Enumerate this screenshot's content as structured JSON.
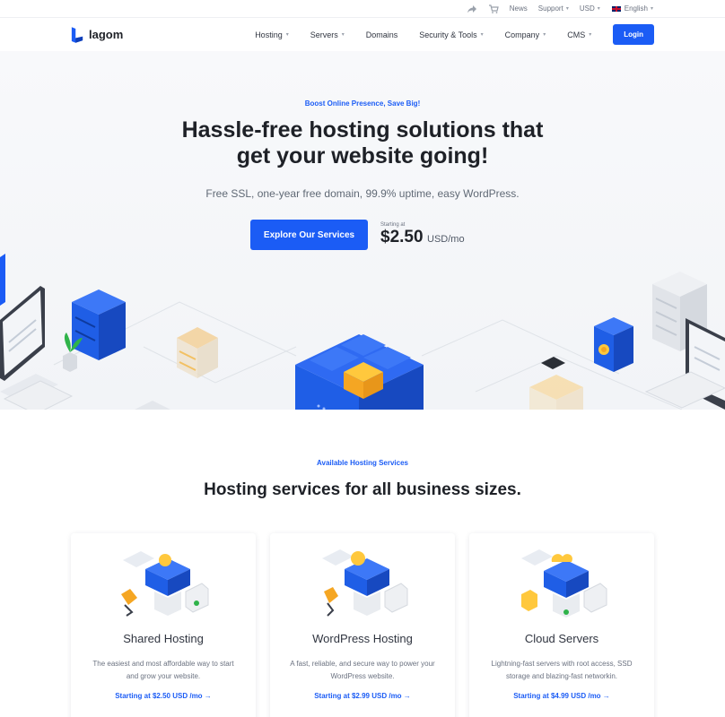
{
  "topbar": {
    "items": [
      {
        "label": "News"
      },
      {
        "label": "Support"
      },
      {
        "label": "USD"
      },
      {
        "label": "English"
      }
    ],
    "icons": [
      "share-icon",
      "cart-icon"
    ]
  },
  "brand": {
    "name": "lagom",
    "color": "#1b5cf5"
  },
  "nav": {
    "items": [
      {
        "label": "Hosting",
        "dropdown": true
      },
      {
        "label": "Servers",
        "dropdown": true
      },
      {
        "label": "Domains",
        "dropdown": false
      },
      {
        "label": "Security & Tools",
        "dropdown": true
      },
      {
        "label": "Company",
        "dropdown": true
      },
      {
        "label": "CMS",
        "dropdown": true
      }
    ],
    "login": "Login"
  },
  "hero": {
    "eyebrow": "Boost Online Presence, Save Big!",
    "title_line1": "Hassle-free hosting solutions that",
    "title_line2": "get your website going!",
    "subtitle": "Free SSL, one-year free domain, 99.9% uptime, easy WordPress.",
    "cta": "Explore Our Services",
    "starting_at": "Starting at",
    "price": "$2.50",
    "price_unit": "USD/mo"
  },
  "services": {
    "eyebrow": "Available Hosting Services",
    "title": "Hosting services for all business sizes.",
    "cards": [
      {
        "title": "Shared Hosting",
        "desc": "The easiest and most affordable way to start and grow your website.",
        "link": "Starting at $2.50 USD /mo  →"
      },
      {
        "title": "WordPress Hosting",
        "desc": "A fast, reliable, and secure way to power your WordPress website.",
        "link": "Starting at $2.99 USD /mo  →"
      },
      {
        "title": "Cloud Servers",
        "desc": "Lightning-fast servers with root access, SSD storage and blazing-fast networkin.",
        "link": "Starting at $4.99 USD /mo  →"
      }
    ]
  }
}
